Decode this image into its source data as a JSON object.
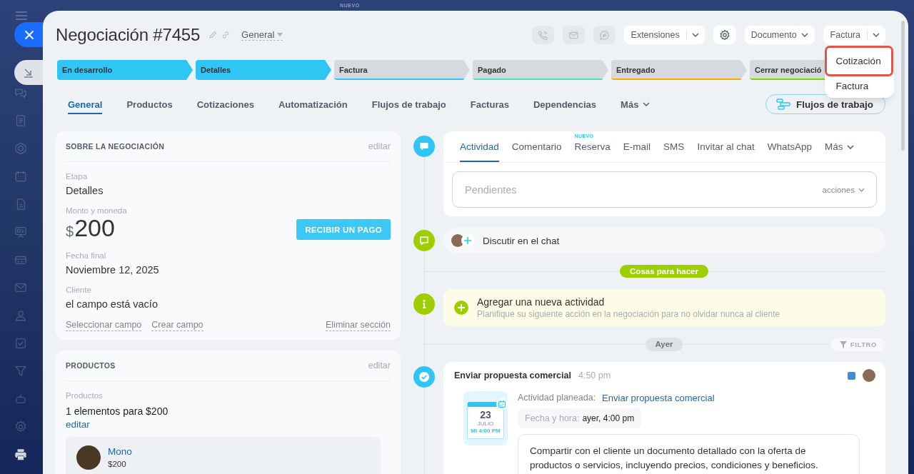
{
  "backdrop": {
    "label": "NUEVO"
  },
  "header": {
    "title": "Negociación #7455",
    "category": "General"
  },
  "toolbar": [
    {
      "kind": "call",
      "disabled": true
    },
    {
      "kind": "mail",
      "disabled": true
    },
    {
      "kind": "chat",
      "disabled": true
    },
    {
      "kind": "split",
      "label": "Extensiones",
      "disabled": false
    },
    {
      "kind": "settings",
      "disabled": false
    },
    {
      "kind": "dropdown",
      "label": "Documento",
      "disabled": false
    },
    {
      "kind": "split",
      "label": "Factura",
      "disabled": false,
      "menu": [
        {
          "label": "Cotización",
          "highlighted": true
        },
        {
          "label": "Factura",
          "highlighted": false
        }
      ]
    }
  ],
  "stages": [
    {
      "label": "En desarrollo",
      "reached": true,
      "color": "#2fc6f6"
    },
    {
      "label": "Detalles",
      "reached": true,
      "color": "#2fc6f6"
    },
    {
      "label": "Factura",
      "reached": false,
      "color": "#2fc6f6"
    },
    {
      "label": "Pagado",
      "reached": false,
      "color": "#47e4c2"
    },
    {
      "label": "Entregado",
      "reached": false,
      "color": "#ffa900"
    },
    {
      "label": "Cerrar negociació",
      "reached": false,
      "color": "#7bd500"
    }
  ],
  "tabs": [
    {
      "label": "General",
      "selected": true,
      "kind": "tab"
    },
    {
      "label": "Productos",
      "selected": false,
      "kind": "tab"
    },
    {
      "label": "Cotizaciones",
      "selected": false,
      "kind": "tab"
    },
    {
      "label": "Automatización",
      "selected": false,
      "kind": "tab"
    },
    {
      "label": "Flujos de trabajo",
      "selected": false,
      "kind": "tab"
    },
    {
      "label": "Facturas",
      "selected": false,
      "kind": "tab"
    },
    {
      "label": "Dependencias",
      "selected": false,
      "kind": "tab"
    },
    {
      "label": "Más",
      "selected": false,
      "kind": "more"
    }
  ],
  "workflow_button": {
    "label": "Flujos de trabajo"
  },
  "deal_card": {
    "title": "SOBRE LA NEGOCIACIÓN",
    "edit": "editar",
    "fields": [
      {
        "kind": "text",
        "label": "Etapa",
        "value": "Detalles"
      },
      {
        "kind": "amount",
        "label": "Monto y moneda",
        "currency": "$",
        "value": "200",
        "action": "RECIBIR UN PAGO"
      },
      {
        "kind": "text",
        "label": "Fecha final",
        "value": "Noviembre 12, 2025"
      },
      {
        "kind": "text",
        "label": "Cliente",
        "value": "el campo está vacío"
      }
    ],
    "links": [
      "Seleccionar campo",
      "Crear campo"
    ],
    "remove": "Eliminar sección"
  },
  "products_card": {
    "title": "PRODUCTOS",
    "edit": "editar",
    "label": "Productos",
    "summary": "1 elementos para $200",
    "edit_link": "editar",
    "items": [
      {
        "name": "Mono",
        "price": "$200"
      }
    ]
  },
  "composer": {
    "tabs": [
      {
        "label": "Actividad",
        "selected": true,
        "kind": "tab"
      },
      {
        "label": "Comentario",
        "selected": false,
        "kind": "tab"
      },
      {
        "label": "Reserva",
        "selected": false,
        "kind": "tab",
        "badge": "NUEVO"
      },
      {
        "label": "E-mail",
        "selected": false,
        "kind": "tab"
      },
      {
        "label": "SMS",
        "selected": false,
        "kind": "tab"
      },
      {
        "label": "Invitar al chat",
        "selected": false,
        "kind": "tab"
      },
      {
        "label": "WhatsApp",
        "selected": false,
        "kind": "tab"
      },
      {
        "label": "Más",
        "selected": false,
        "kind": "more"
      }
    ],
    "placeholder": "Pendientes",
    "actions": "acciones"
  },
  "chat_row": {
    "label": "Discutir en el chat"
  },
  "todo_divider": {
    "label": "Cosas para hacer"
  },
  "add_activity": {
    "title": "Agregar una nueva actividad",
    "hint": "Planifique su siguiente acción en la negociación para no olvidar nunca al cliente"
  },
  "day_divider": {
    "label": "Ayer",
    "filter": "FILTRO"
  },
  "activity": {
    "title": "Enviar propuesta comercial",
    "time": "4:50 pm",
    "calendar": {
      "day": "23",
      "month": "JULIO",
      "time": "MI 4:00 PM"
    },
    "planned_label": "Actividad planeada:",
    "planned_link": "Enviar propuesta comercial",
    "datetime_label": "Fecha y hora:",
    "datetime_value": "ayer, 4:00 pm",
    "description": "Compartir con el cliente un documento detallado con la oferta de productos o servicios, incluyendo precios, condiciones y beneficios."
  }
}
